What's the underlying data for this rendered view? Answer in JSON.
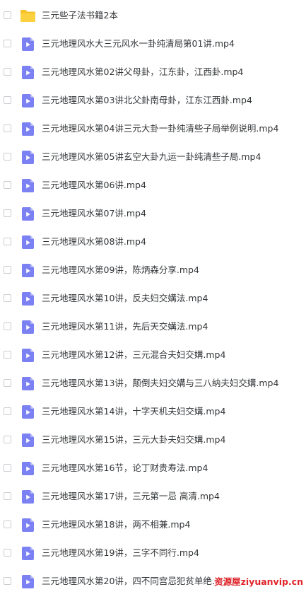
{
  "colors": {
    "video_icon": "#7b81f2",
    "video_icon_fold": "#b4b8f8",
    "folder_icon": "#fbd140",
    "folder_tab": "#f6c22a",
    "text": "#333639",
    "checkbox_border": "#c9ccd1",
    "watermark": "#e0242a"
  },
  "files": [
    {
      "name": "三元些子法书籍2本",
      "icon": "folder-icon"
    },
    {
      "name": "三元地理风水大三元风水一卦纯清局第01讲.mp4",
      "icon": "video-file-icon"
    },
    {
      "name": "三元地理风水第02讲父母卦，江东卦，江西卦.mp4",
      "icon": "video-file-icon"
    },
    {
      "name": "三元地理风水第03讲北父卦南母卦，江东江西卦.mp4",
      "icon": "video-file-icon"
    },
    {
      "name": "三元地理风水第04讲三元大卦一卦纯清些子局举例说明.mp4",
      "icon": "video-file-icon"
    },
    {
      "name": "三元地理风水第05讲玄空大卦九运一卦纯清些子局.mp4",
      "icon": "video-file-icon"
    },
    {
      "name": "三元地理风水第06讲.mp4",
      "icon": "video-file-icon"
    },
    {
      "name": "三元地理风水第07讲.mp4",
      "icon": "video-file-icon"
    },
    {
      "name": "三元地理风水第08讲.mp4",
      "icon": "video-file-icon"
    },
    {
      "name": "三元地理风水第09讲，陈炳森分享.mp4",
      "icon": "video-file-icon"
    },
    {
      "name": "三元地理风水第10讲，反夫妇交媾法.mp4",
      "icon": "video-file-icon"
    },
    {
      "name": "三元地理风水第11讲，先后天交媾法.mp4",
      "icon": "video-file-icon"
    },
    {
      "name": "三元地理风水第12讲，三元混合夫妇交媾.mp4",
      "icon": "video-file-icon"
    },
    {
      "name": "三元地理风水第13讲，颠倒夫妇交媾与三八纳夫妇交媾.mp4",
      "icon": "video-file-icon"
    },
    {
      "name": "三元地理风水第14讲，十字天机夫妇交媾.mp4",
      "icon": "video-file-icon"
    },
    {
      "name": "三元地理风水第15讲，三元大卦夫妇交媾.mp4",
      "icon": "video-file-icon"
    },
    {
      "name": "三元地理风水第16节，论丁财贵寿法.mp4",
      "icon": "video-file-icon"
    },
    {
      "name": "三元地理风水第17讲，三元第一忌 高清.mp4",
      "icon": "video-file-icon"
    },
    {
      "name": "三元地理风水第18讲，两不相兼.mp4",
      "icon": "video-file-icon"
    },
    {
      "name": "三元地理风水第19讲，三字不同行.mp4",
      "icon": "video-file-icon"
    },
    {
      "name": "三元地理风水第20讲，四不同宫忌犯贫单绝.mp4",
      "icon": "video-file-icon"
    }
  ],
  "watermark": "资源屋ziyuanvip.cn"
}
